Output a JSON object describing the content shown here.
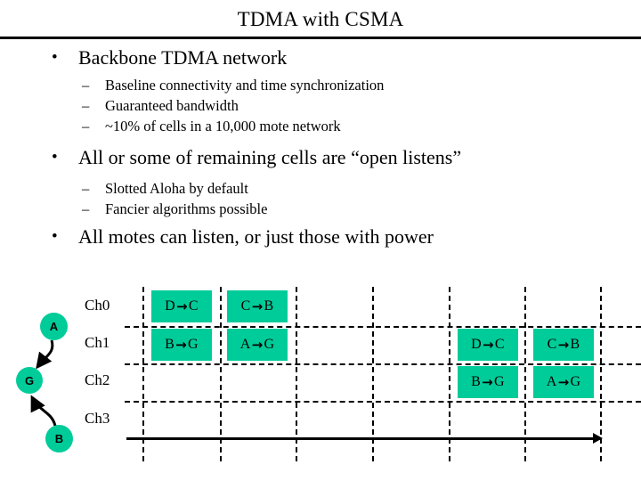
{
  "slide": {
    "title": "TDMA with CSMA",
    "bullets": [
      {
        "level": 1,
        "marker": "•",
        "text": "Backbone TDMA network"
      },
      {
        "level": 2,
        "marker": "–",
        "text": "Baseline connectivity and time synchronization"
      },
      {
        "level": 2,
        "marker": "–",
        "text": "Guaranteed bandwidth"
      },
      {
        "level": 2,
        "marker": "–",
        "text": "~10% of cells in a 10,000 mote network"
      },
      {
        "level": 1,
        "marker": "•",
        "text": "All or some of remaining cells are “open listens”"
      },
      {
        "level": 2,
        "marker": "–",
        "text": "Slotted Aloha by default"
      },
      {
        "level": 2,
        "marker": "–",
        "text": "Fancier algorithms possible"
      },
      {
        "level": 1,
        "marker": "•",
        "text": "All motes can listen, or just those with power"
      }
    ]
  },
  "diagram": {
    "channel_labels": [
      "Ch0",
      "Ch1",
      "Ch2",
      "Ch3"
    ],
    "cell_fill_color": "#00cc99",
    "grid_color": "#000000",
    "slots": [
      {
        "channel": "Ch0",
        "slot": 1,
        "from": "D",
        "to": "C",
        "arrow": "→"
      },
      {
        "channel": "Ch0",
        "slot": 2,
        "from": "C",
        "to": "B",
        "arrow": "→"
      },
      {
        "channel": "Ch1",
        "slot": 1,
        "from": "B",
        "to": "G",
        "arrow": "→"
      },
      {
        "channel": "Ch1",
        "slot": 2,
        "from": "A",
        "to": "G",
        "arrow": "→"
      },
      {
        "channel": "Ch1",
        "slot": 5,
        "from": "D",
        "to": "C",
        "arrow": "→"
      },
      {
        "channel": "Ch1",
        "slot": 6,
        "from": "C",
        "to": "B",
        "arrow": "→"
      },
      {
        "channel": "Ch2",
        "slot": 5,
        "from": "B",
        "to": "G",
        "arrow": "→"
      },
      {
        "channel": "Ch2",
        "slot": 6,
        "from": "A",
        "to": "G",
        "arrow": "→"
      }
    ],
    "nodes": [
      {
        "id": "A",
        "label": "A"
      },
      {
        "id": "G",
        "label": "G"
      },
      {
        "id": "B",
        "label": "B"
      }
    ],
    "links": [
      {
        "from": "A",
        "to": "G"
      },
      {
        "from": "B",
        "to": "G"
      }
    ]
  }
}
